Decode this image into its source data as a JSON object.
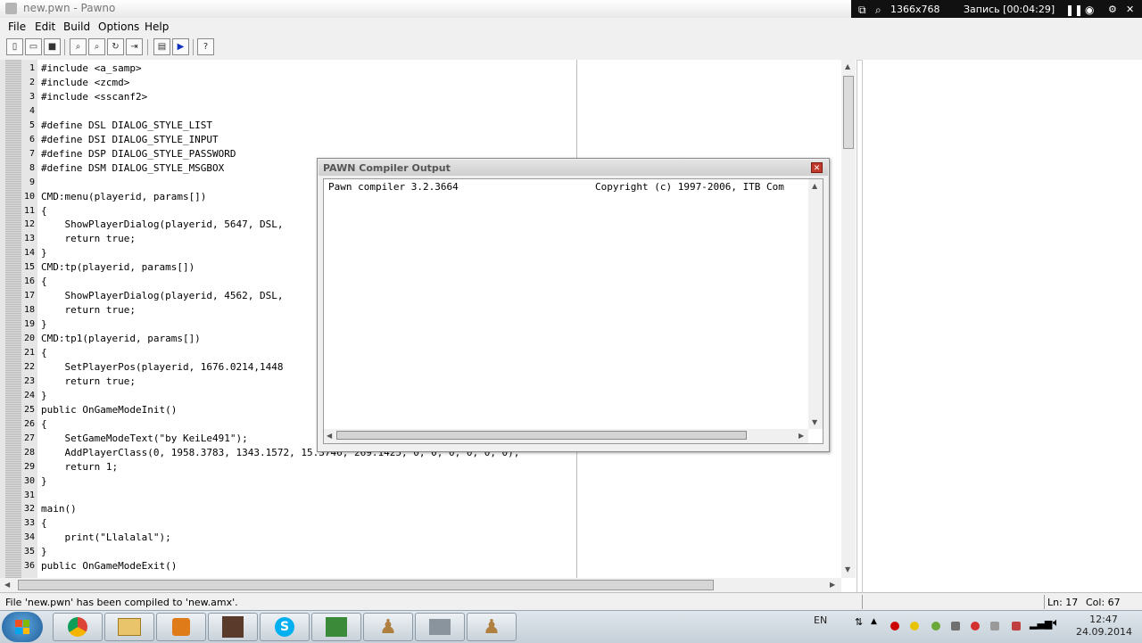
{
  "window": {
    "title": "new.pwn - Pawno"
  },
  "recorder": {
    "resolution": "1366x768",
    "recording": "Запись [00:04:29]"
  },
  "menu": {
    "items": [
      "File",
      "Edit",
      "Build",
      "Options",
      "Help"
    ]
  },
  "editor": {
    "line_numbers": [
      "1",
      "2",
      "3",
      "4",
      "5",
      "6",
      "7",
      "8",
      "9",
      "10",
      "11",
      "12",
      "13",
      "14",
      "15",
      "16",
      "17",
      "18",
      "19",
      "20",
      "21",
      "22",
      "23",
      "24",
      "25",
      "26",
      "27",
      "28",
      "29",
      "30",
      "31",
      "32",
      "33",
      "34",
      "35",
      "36"
    ],
    "lines": [
      "#include <a_samp>",
      "#include <zcmd>",
      "#include <sscanf2>",
      "",
      "#define DSL DIALOG_STYLE_LIST",
      "#define DSI DIALOG_STYLE_INPUT",
      "#define DSP DIALOG_STYLE_PASSWORD",
      "#define DSM DIALOG_STYLE_MSGBOX",
      "",
      "CMD:menu(playerid, params[])",
      "{",
      "    ShowPlayerDialog(playerid, 5647, DSL,",
      "    return true;",
      "}",
      "CMD:tp(playerid, params[])",
      "{",
      "    ShowPlayerDialog(playerid, 4562, DSL,",
      "    return true;",
      "}",
      "CMD:tp1(playerid, params[])",
      "{",
      "    SetPlayerPos(playerid, 1676.0214,1448",
      "    return true;",
      "}",
      "public OnGameModeInit()",
      "{",
      "    SetGameModeText(\"by KeiLe491\");",
      "    AddPlayerClass(0, 1958.3783, 1343.1572, 15.3746, 269.1425, 0, 0, 0, 0, 0, 0);",
      "    return 1;",
      "}",
      "",
      "main()",
      "{",
      "    print(\"Llalalal\");",
      "}",
      "public OnGameModeExit()"
    ]
  },
  "compiler": {
    "title": "PAWN Compiler Output",
    "version": "Pawn compiler 3.2.3664",
    "copyright": "Copyright (c) 1997-2006, ITB Com"
  },
  "status": {
    "message": "File 'new.pwn' has been compiled to 'new.amx'.",
    "line": "Ln: 17",
    "column": "Col: 67"
  },
  "taskbar": {
    "language": "EN",
    "time": "12:47",
    "date": "24.09.2014"
  },
  "colors": {
    "gutter": "#e6e6e6",
    "dialog_close": "#c0392b",
    "taskbar": "#c6d0d8",
    "recorder": "#111111"
  }
}
